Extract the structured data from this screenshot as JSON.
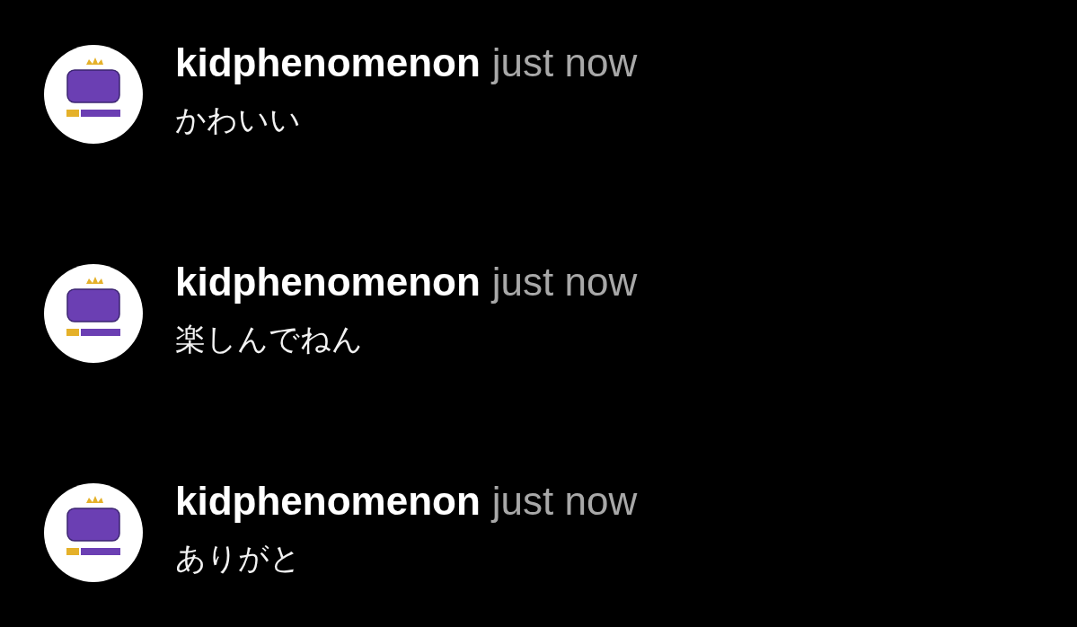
{
  "comments": [
    {
      "username": "kidphenomenon",
      "time": "just now",
      "text": "かわいい"
    },
    {
      "username": "kidphenomenon",
      "time": "just now",
      "text": "楽しんでねん"
    },
    {
      "username": "kidphenomenon",
      "time": "just now",
      "text": "ありがと"
    }
  ]
}
